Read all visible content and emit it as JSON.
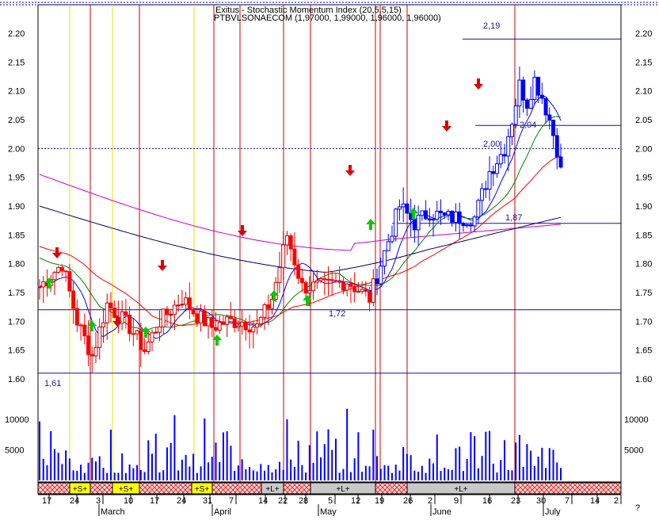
{
  "chart_data": {
    "type": "candlestick",
    "title": "Exitus - Stochastic Momentum Index (20,5,5,15)",
    "subtitle": "PTBVLSONAECOM (1,97000, 1,99000, 1,96000, 1,96000)",
    "price_axis": {
      "min": 1.58,
      "max": 2.23,
      "ticks": [
        "2.20",
        "2.15",
        "2.10",
        "2.05",
        "2.00",
        "1.95",
        "1.90",
        "1.85",
        "1.80",
        "1.75",
        "1.70",
        "1.65",
        "1.60"
      ]
    },
    "volume_axis": {
      "max": 12500,
      "ticks": [
        "10000",
        "5000"
      ]
    },
    "x_ticks": [
      "17",
      "24",
      "3",
      "10",
      "17",
      "24",
      "31",
      "7",
      "14",
      "22",
      "28",
      "5",
      "12",
      "19",
      "26",
      "2",
      "9",
      "16",
      "23",
      "30",
      "7",
      "14",
      "2"
    ],
    "month_labels": [
      "March",
      "April",
      "May",
      "June",
      "July"
    ],
    "question_mark": "?",
    "annotations": [
      {
        "text": "2,19",
        "value": 2.19
      },
      {
        "text": "2,04",
        "value": 2.04
      },
      {
        "text": "2,00",
        "value": 2.0
      },
      {
        "text": "1,87",
        "value": 1.87
      },
      {
        "text": "1,72",
        "value": 1.72
      },
      {
        "text": "1,61",
        "value": 1.61
      }
    ],
    "horizontal_levels": [
      2.19,
      2.04,
      2.0,
      1.87,
      1.72,
      1.61
    ],
    "zones": [
      {
        "label": "+S+",
        "color": "#ffff00"
      },
      {
        "label": "+S+",
        "color": "#ffff00"
      },
      {
        "label": "+S+",
        "color": "#ffff00"
      },
      {
        "label": "+L+",
        "color": "#c8c8c8"
      },
      {
        "label": "+L+",
        "color": "#c8c8c8"
      },
      {
        "label": "+L+",
        "color": "#c8c8c8"
      }
    ],
    "series": [
      {
        "color": "#cc0000",
        "values": []
      },
      {
        "color": "#0000cc",
        "values": []
      }
    ],
    "colors": {
      "up": "#ffffff",
      "down": "#ff0000",
      "upBlue": "#0000ff",
      "ma_fast": "#0000ff",
      "ma_mid": "#008000",
      "ma_red": "#ff0000",
      "ma_magenta": "#cc00cc",
      "ma_navy": "#000066",
      "vline_red": "#cc0000",
      "vline_yellow": "#e6e600",
      "arrow_up": "#00cc00",
      "arrow_down": "#dd0000",
      "level_line": "#1010a0"
    }
  }
}
